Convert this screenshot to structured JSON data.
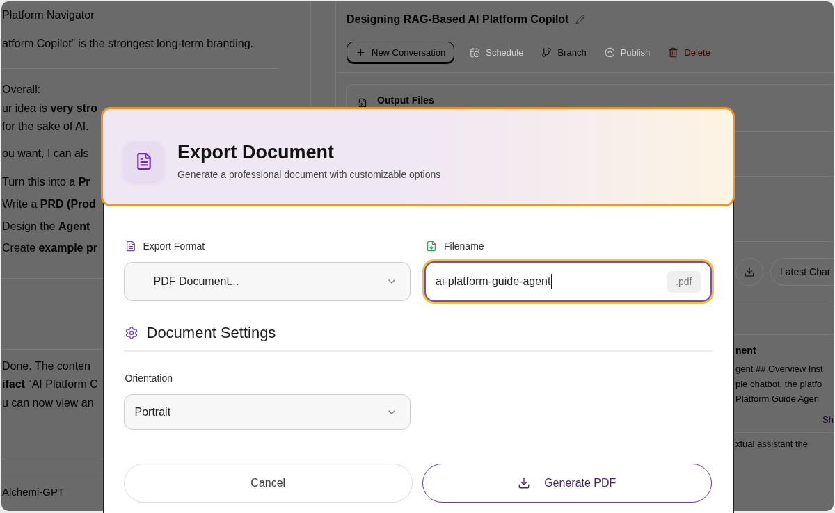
{
  "chat": {
    "sections": [
      {
        "paragraphs": [
          {
            "kind": "list",
            "lines": [
              "Platform Navigator"
            ]
          },
          {
            "kind": "text",
            "lines": [
              "atform Copilot” is the strongest long-term branding."
            ]
          }
        ]
      },
      {
        "paragraphs": [
          {
            "kind": "text",
            "lines": [
              "Overall:",
              "ur idea is **very stro**",
              "for the sake of AI."
            ]
          },
          {
            "kind": "text",
            "lines": [
              "ou want, I can als"
            ]
          },
          {
            "kind": "list",
            "lines": [
              "Turn this into a **Pr**",
              "Write a **PRD (Prod**",
              "Design the **Agent**",
              "Create **example pr**"
            ]
          }
        ]
      },
      {
        "paragraphs": [
          {
            "kind": "text",
            "lines": [
              "Done. The conten",
              "**ifact** “AI Platform C",
              "u can now view an"
            ]
          }
        ]
      }
    ],
    "footer": "Alchemi-GPT"
  },
  "conversation": {
    "title": "Designing RAG-Based AI Platform Copilot",
    "actions": [
      {
        "label": "New Conversation",
        "kind": "outlined",
        "disabled": false
      },
      {
        "label": "Schedule",
        "kind": "plain",
        "disabled": true
      },
      {
        "label": "Branch",
        "kind": "plain",
        "disabled": false
      },
      {
        "label": "Publish",
        "kind": "plain",
        "disabled": true
      },
      {
        "label": "Delete",
        "kind": "danger",
        "disabled": false
      }
    ]
  },
  "output_files": {
    "title": "Output Files",
    "latest_button": "Latest Char",
    "document": {
      "title": "nent",
      "lines": [
        "gent ## Overview Inst",
        "ple chatbot, the platfo",
        "Platform Guide Agen"
      ],
      "link": "Sh"
    },
    "next_line": "xtual assistant the"
  },
  "export_dialog": {
    "title": "Export Document",
    "subtitle": "Generate a professional document with customizable options",
    "format": {
      "label": "Export Format",
      "value": "PDF Document..."
    },
    "filename": {
      "label": "Filename",
      "value": "ai-platform-guide-agent",
      "extension": ".pdf",
      "focused": true
    },
    "settings": {
      "title": "Document Settings",
      "fields": [
        {
          "label": "Orientation",
          "value": "Portrait"
        }
      ]
    },
    "buttons": [
      {
        "label": "Cancel",
        "kind": "secondary"
      },
      {
        "label": "Generate PDF",
        "kind": "primary"
      }
    ]
  }
}
